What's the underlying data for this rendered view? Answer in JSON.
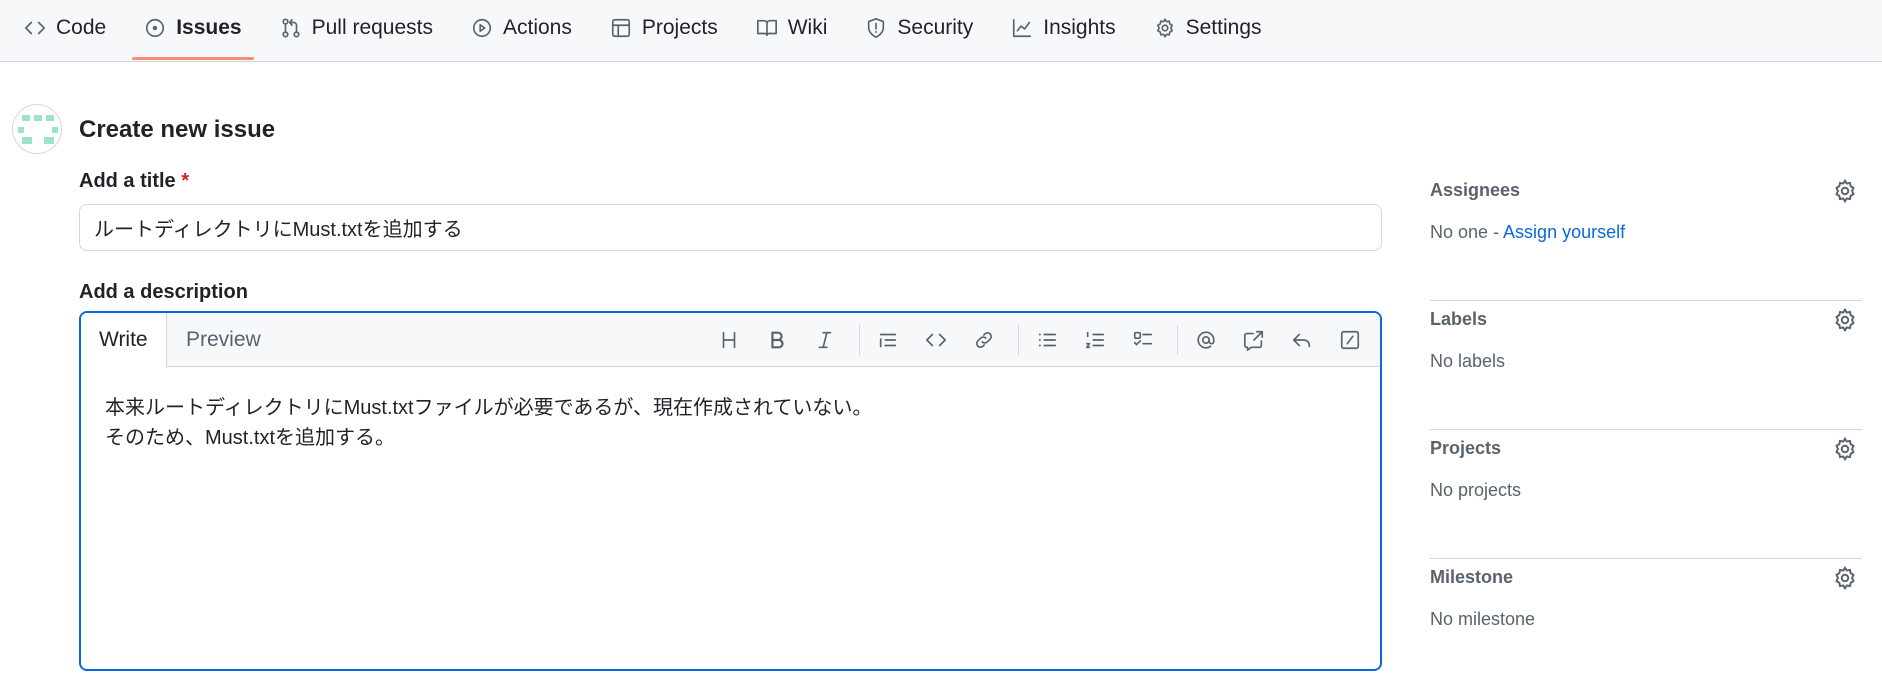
{
  "nav": {
    "tabs": [
      {
        "label": "Code",
        "icon": "code-icon"
      },
      {
        "label": "Issues",
        "icon": "issue-opened-icon",
        "active": true
      },
      {
        "label": "Pull requests",
        "icon": "pull-request-icon"
      },
      {
        "label": "Actions",
        "icon": "play-icon"
      },
      {
        "label": "Projects",
        "icon": "table-icon"
      },
      {
        "label": "Wiki",
        "icon": "book-icon"
      },
      {
        "label": "Security",
        "icon": "shield-icon"
      },
      {
        "label": "Insights",
        "icon": "graph-icon"
      },
      {
        "label": "Settings",
        "icon": "gear-icon"
      }
    ]
  },
  "page": {
    "title": "Create new issue"
  },
  "form": {
    "title_label": "Add a title",
    "required_mark": "*",
    "title_value": "ルートディレクトリにMust.txtを追加する",
    "description_label": "Add a description",
    "editor_tabs": {
      "write": "Write",
      "preview": "Preview"
    },
    "description_lines": [
      "本来ルートディレクトリにMust.txtファイルが必要であるが、現在作成されていない。",
      "そのため、Must.txtを追加する。"
    ]
  },
  "sidebar": {
    "assignees": {
      "title": "Assignees",
      "value": "No one - ",
      "link": "Assign yourself"
    },
    "labels": {
      "title": "Labels",
      "value": "No labels"
    },
    "projects": {
      "title": "Projects",
      "value": "No projects"
    },
    "milestone": {
      "title": "Milestone",
      "value": "No milestone"
    }
  },
  "colors": {
    "accent": "#0969da",
    "active_tab_underline": "#fd8c73",
    "required": "#d1242f"
  }
}
